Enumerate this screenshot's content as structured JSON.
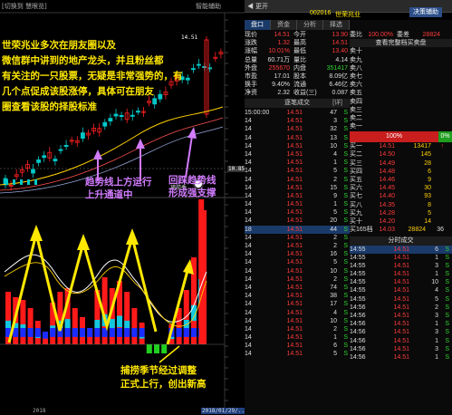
{
  "chart": {
    "toolbar": {
      "left": "[切换到 慧眼览]",
      "right": "智能辅助"
    },
    "price_high_label": "14.51",
    "price_level_label": "10.85",
    "year_label": "2018",
    "date_label": "2018/01/29/...",
    "indicator_label": "捕捞季",
    "annotation_main": [
      "世荣兆业多次在朋友圈以及",
      "微信群中讲到的地产龙头，并且粉丝都",
      "有关注的一只股票，无疑是非常强势的，有",
      "几个点促成该股涨停，具体可在朋友",
      "圈查看该股的择股标准"
    ],
    "annotation_trend": [
      "趋势线上方运行",
      "上升通道中"
    ],
    "annotation_support": [
      "回踩趋势线",
      "形成强支撑"
    ],
    "annotation_bottom": [
      "捕捞季节经过调整",
      "正式上行，创出新高"
    ],
    "colors": {
      "annotation_yellow": "#ffe800",
      "annotation_purple": "#d27cff",
      "up": "#ff2020",
      "down": "#00c8c8"
    }
  },
  "panel": {
    "top_label": "◀ 更开",
    "stock_code": "002016",
    "stock_name": "世荣兆业",
    "button": "决策辅助",
    "tabs": [
      "盘口",
      "资金",
      "分析",
      "择选"
    ],
    "quotes": [
      {
        "l1": "现价",
        "v1": "14.51",
        "l2": "今开",
        "v2": "13.90"
      },
      {
        "l1": "涨跌",
        "v1": "1.32",
        "l2": "最高",
        "v2": "14.51"
      },
      {
        "l1": "涨幅",
        "v1": "10.01%",
        "l2": "最低",
        "v2": "13.40"
      },
      {
        "l1": "总量",
        "v1": "60.71万",
        "l2": "量比",
        "v2": "4.14"
      },
      {
        "l1": "外盘",
        "v1": "255670",
        "l2": "内盘",
        "v2": "351417"
      },
      {
        "l1": "市盈",
        "v1": "17.01",
        "l2": "股本",
        "v2": "8.09亿"
      },
      {
        "l1": "换手",
        "v1": "9.40%",
        "l2": "流通",
        "v2": "6.46亿"
      },
      {
        "l1": "净资",
        "v1": "2.32",
        "l2": "收益(三)",
        "v2": "0.087"
      }
    ],
    "trades_header": "逐笔成交",
    "trades_extra": "[详]",
    "trades": [
      {
        "t": "15:00:00",
        "p": "14.51",
        "v": "47",
        "f": "S"
      },
      {
        "t": "14",
        "p": "14.51",
        "v": "3",
        "f": "S"
      },
      {
        "t": "14",
        "p": "14.51",
        "v": "32",
        "f": "S"
      },
      {
        "t": "14",
        "p": "14.51",
        "v": "13",
        "f": "S"
      },
      {
        "t": "14",
        "p": "14.51",
        "v": "10",
        "f": "S"
      },
      {
        "t": "14",
        "p": "14.51",
        "v": "4",
        "f": "S"
      },
      {
        "t": "14",
        "p": "14.51",
        "v": "1",
        "f": "S"
      },
      {
        "t": "14",
        "p": "14.51",
        "v": "5",
        "f": "S"
      },
      {
        "t": "14",
        "p": "14.51",
        "v": "2",
        "f": "S"
      },
      {
        "t": "14",
        "p": "14.51",
        "v": "15",
        "f": "S"
      },
      {
        "t": "14",
        "p": "14.51",
        "v": "9",
        "f": "S"
      },
      {
        "t": "14",
        "p": "14.51",
        "v": "1",
        "f": "S"
      },
      {
        "t": "14",
        "p": "14.51",
        "v": "5",
        "f": "S"
      },
      {
        "t": "14",
        "p": "14.51",
        "v": "20",
        "f": "S"
      },
      {
        "t": "18",
        "p": "14.51",
        "v": "44",
        "f": "S"
      },
      {
        "t": "14",
        "p": "14.51",
        "v": "2",
        "f": "S"
      },
      {
        "t": "14",
        "p": "14.51",
        "v": "2",
        "f": "S"
      },
      {
        "t": "14",
        "p": "14.51",
        "v": "16",
        "f": "S"
      },
      {
        "t": "14",
        "p": "14.51",
        "v": "5",
        "f": "S"
      },
      {
        "t": "14",
        "p": "14.51",
        "v": "10",
        "f": "S"
      },
      {
        "t": "14",
        "p": "14.51",
        "v": "2",
        "f": "S"
      },
      {
        "t": "14",
        "p": "14.51",
        "v": "74",
        "f": "S"
      },
      {
        "t": "14",
        "p": "14.51",
        "v": "38",
        "f": "S"
      },
      {
        "t": "14",
        "p": "14.51",
        "v": "17",
        "f": "S"
      },
      {
        "t": "14",
        "p": "14.51",
        "v": "4",
        "f": "S"
      },
      {
        "t": "14",
        "p": "14.51",
        "v": "10",
        "f": "S"
      },
      {
        "t": "14",
        "p": "14.51",
        "v": "2",
        "f": "S"
      },
      {
        "t": "14",
        "p": "14.51",
        "v": "1",
        "f": "S"
      },
      {
        "t": "14",
        "p": "14.51",
        "v": "6",
        "f": "S"
      },
      {
        "t": "14",
        "p": "14.51",
        "v": "5",
        "f": "S"
      }
    ],
    "ob_header": {
      "label": "委比",
      "v1": "100.00%",
      "l2": "委差",
      "v2": "28824"
    },
    "ob_link": "查看完整档买卖盘",
    "sells": [
      "卖十",
      "卖九",
      "卖八",
      "卖七",
      "卖六",
      "卖五",
      "卖四",
      "卖三",
      "卖二",
      "卖一"
    ],
    "ratio_bar": {
      "left": "100%",
      "right": "0%"
    },
    "buys": [
      {
        "l": "买一",
        "p": "14.51",
        "v": "13417",
        "x": "↑"
      },
      {
        "l": "买二",
        "p": "14.50",
        "v": "145",
        "x": ""
      },
      {
        "l": "买三",
        "p": "14.49",
        "v": "28",
        "x": ""
      },
      {
        "l": "买四",
        "p": "14.48",
        "v": "6",
        "x": ""
      },
      {
        "l": "买五",
        "p": "14.46",
        "v": "9",
        "x": ""
      },
      {
        "l": "买六",
        "p": "14.45",
        "v": "30",
        "x": ""
      },
      {
        "l": "买七",
        "p": "14.40",
        "v": "93",
        "x": ""
      },
      {
        "l": "买八",
        "p": "14.35",
        "v": "8",
        "x": ""
      },
      {
        "l": "买九",
        "p": "14.28",
        "v": "5",
        "x": ""
      },
      {
        "l": "买十",
        "p": "14.20",
        "v": "14",
        "x": ""
      }
    ],
    "buy_total": {
      "l": "买165档",
      "p": "14.03",
      "v": "28824",
      "x": "36"
    },
    "min_header": "分时成交",
    "min_trades": [
      {
        "t": "14:55",
        "p": "14.51",
        "v": "6",
        "f": "S"
      },
      {
        "t": "14:55",
        "p": "14.51",
        "v": "1",
        "f": "S"
      },
      {
        "t": "14:55",
        "p": "14.51",
        "v": "3",
        "f": "S"
      },
      {
        "t": "14:55",
        "p": "14.51",
        "v": "1",
        "f": "S"
      },
      {
        "t": "14:55",
        "p": "14.51",
        "v": "10",
        "f": "S"
      },
      {
        "t": "14:55",
        "p": "14.51",
        "v": "4",
        "f": "S"
      },
      {
        "t": "14:55",
        "p": "14.51",
        "v": "5",
        "f": "S"
      },
      {
        "t": "14:56",
        "p": "14.51",
        "v": "2",
        "f": "S"
      },
      {
        "t": "14:56",
        "p": "14.51",
        "v": "3",
        "f": "S"
      },
      {
        "t": "14:56",
        "p": "14.51",
        "v": "1",
        "f": "S"
      },
      {
        "t": "14:56",
        "p": "14.51",
        "v": "3",
        "f": "S"
      },
      {
        "t": "14:56",
        "p": "14.51",
        "v": "1",
        "f": "S"
      },
      {
        "t": "14:56",
        "p": "14.51",
        "v": "3",
        "f": "S"
      },
      {
        "t": "14:56",
        "p": "14.51",
        "v": "1",
        "f": "S"
      }
    ],
    "colors": {
      "up": "#ff3a3a",
      "down": "#2fd32f",
      "highlight_bg": "#1a3a6a"
    }
  }
}
